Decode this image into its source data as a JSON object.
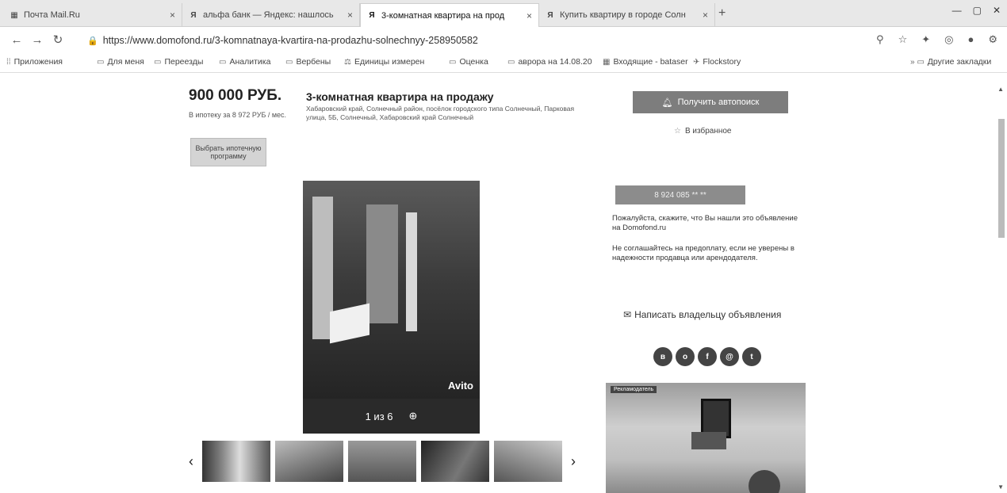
{
  "browser": {
    "tabs": [
      {
        "label": "Почта Mail.Ru",
        "icon": "mail-icon",
        "active": false
      },
      {
        "label": "альфа банк — Яндекс: нашлось",
        "icon": "yandex-icon",
        "active": false
      },
      {
        "label": "3-комнатная квартира на прод",
        "icon": "domofond-icon",
        "active": true
      },
      {
        "label": "Купить квартиру в городе Солн",
        "icon": "domofond-icon",
        "active": false
      }
    ],
    "url": "https://www.domofond.ru/3-komnatnaya-kvartira-na-prodazhu-solnechnyy-258950582",
    "bookmarks": [
      {
        "label": "Приложения",
        "icon": "apps-icon"
      },
      {
        "label": "Для меня",
        "icon": "folder-icon"
      },
      {
        "label": "Переезды",
        "icon": "folder-icon"
      },
      {
        "label": "Аналитика",
        "icon": "folder-icon"
      },
      {
        "label": "Вербены",
        "icon": "folder-icon"
      },
      {
        "label": "Единицы измерен",
        "icon": "folder-icon"
      },
      {
        "label": "Оценка",
        "icon": "folder-icon"
      },
      {
        "label": "аврора на 14.08.20",
        "icon": "folder-icon"
      },
      {
        "label": "Входящие - bataser",
        "icon": "mail-icon"
      },
      {
        "label": "Flockstory",
        "icon": "bird-icon"
      },
      {
        "label": "Другие закладки",
        "icon": "folder-icon"
      }
    ]
  },
  "listing": {
    "price": "900 000 РУБ.",
    "mortgage_note": "В ипотеку за 8 972 РУБ / мес.",
    "mortgage_button": "Выбрать ипотечную программу",
    "title": "3-комнатная квартира на продажу",
    "address": "Хабаровский край, Солнечный район, посёлок городского типа Солнечный, Парковая улица, 5Б, Солнечный, Хабаровский край Солнечный",
    "notify_button": "Получить автопоиск",
    "favorite": "В избранное",
    "phone_button": "8 924 085 ** **",
    "notice1": "Пожалуйста, скажите, что Вы нашли это объявление на Domofond.ru",
    "notice2": "Не соглашайтесь на предоплату, если не уверены в надежности продавца или арендодателя.",
    "write_owner": "Написать владельцу объявления",
    "photo_counter": "1 из 6",
    "photo_source": "Avito",
    "ad_label": "Рекламодатель"
  },
  "socials": [
    "vk-icon",
    "ok-icon",
    "fb-icon",
    "mailru-icon",
    "twitter-icon"
  ]
}
